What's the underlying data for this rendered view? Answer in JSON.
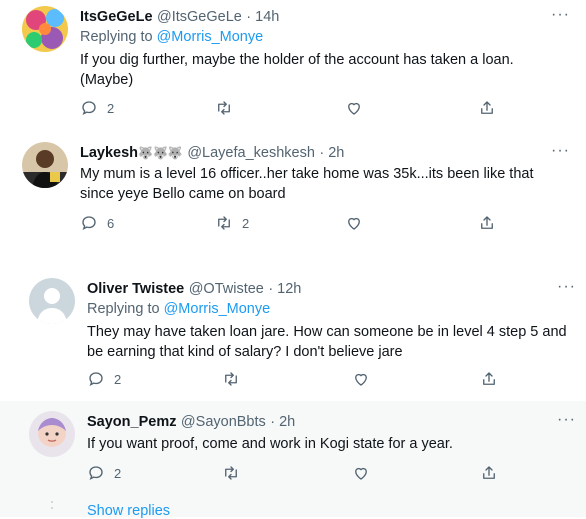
{
  "tweets": [
    {
      "name": "ItsGeGeLe",
      "handle": "@ItsGeGeLe",
      "time": "· 14h",
      "replying_prefix": "Replying to",
      "replying_to": "@Morris_Monye",
      "text": [
        "If you dig further, maybe the holder of the account has taken a loan.",
        "(Maybe)"
      ],
      "replies": "2",
      "retweets": "",
      "likes": ""
    },
    {
      "name": "Laykesh",
      "emoji": "🐺🐺🐺",
      "handle": "@Layefa_keshkesh",
      "time": "· 2h",
      "text": [
        "My mum is a level 16 officer..her take home was 35k...its been like that",
        "since yeye Bello came on board"
      ],
      "replies": "6",
      "retweets": "2",
      "likes": ""
    },
    {
      "name": "Oliver Twistee",
      "handle": "@OTwistee",
      "time": "· 12h",
      "replying_prefix": "Replying to",
      "replying_to": "@Morris_Monye",
      "text": [
        "They may have taken loan jare. How can someone be in level 4 step 5 and",
        "be earning that kind of salary? I don't believe jare"
      ],
      "replies": "2",
      "retweets": "",
      "likes": ""
    },
    {
      "name": "Sayon_Pemz",
      "handle": "@SayonBbts",
      "time": "· 2h",
      "text": [
        "If you want proof, come and work in Kogi state for a year."
      ],
      "replies": "2",
      "retweets": "",
      "likes": ""
    }
  ],
  "show_replies": "Show replies",
  "more_glyph": "···",
  "icons": [
    "reply-icon",
    "retweet-icon",
    "like-icon",
    "share-icon",
    "more-icon"
  ],
  "colors": {
    "accent": "#1d9bf0",
    "secondary_text": "#536471",
    "shaded_bg": "#f7f9f9"
  }
}
